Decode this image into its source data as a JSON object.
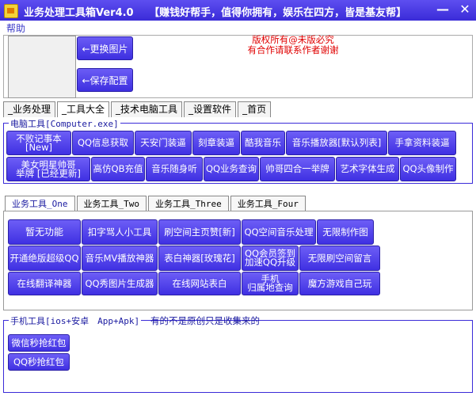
{
  "window": {
    "title": "业务处理工具箱Ver4.0　　【赚钱好帮手，值得你拥有，娱乐在四方，皆是基友帮】",
    "minimize": "—",
    "close": "✕"
  },
  "menu": {
    "help": "帮助"
  },
  "side_buttons": {
    "change_image": "←更换图片",
    "save_config": "←保存配置"
  },
  "copyright": {
    "line1": "版权所有@未版必究",
    "line2": "有合作请联系作者谢谢"
  },
  "main_tabs": [
    "_业务处理",
    "_工具大全",
    "_技术电脑工具",
    "_设置软件",
    "_首页"
  ],
  "computer_tools": {
    "title": "电脑工具[Computer.exe]",
    "row1": [
      "不败记事本\n[New]",
      "QQ信息获取",
      "天安门装逼",
      "刻章装逼",
      "酷我音乐",
      "音乐播放器[默认列表]",
      "手拿资料装逼"
    ],
    "row2": [
      "美女明星帅哥\n举牌 [已经更新]",
      "高仿QB充值",
      "音乐随身听",
      "QQ业务查询",
      "帅哥四合一举牌",
      "艺术字体生成",
      "QQ头像制作"
    ]
  },
  "business_tabs": [
    "业务工具_One",
    "业务工具_Two",
    "业务工具_Three",
    "业务工具_Four"
  ],
  "business_tools": {
    "row1": [
      "暂无功能",
      "扣字骂人小工具",
      "刷空间主页赞[新]",
      "QQ空间音乐处理",
      "无限制作图"
    ],
    "row2": [
      "开通绝版超级QQ",
      "音乐MV播放神器",
      "表白神器[玫瑰花]",
      "QQ会员签到\n加速QQ升级",
      "无限刷空间留言"
    ],
    "row3": [
      "在线翻译神器",
      "QQ秀图片生成器",
      "在线网站表白",
      "手机\n归属地查询",
      "魔方游戏自己玩"
    ]
  },
  "mobile_tools": {
    "title": "手机工具[ios+安卓　App+Apk]",
    "note": "有的不是原创只是收集来的",
    "buttons": [
      "微信秒抢红包",
      "QQ秒抢红包"
    ]
  }
}
